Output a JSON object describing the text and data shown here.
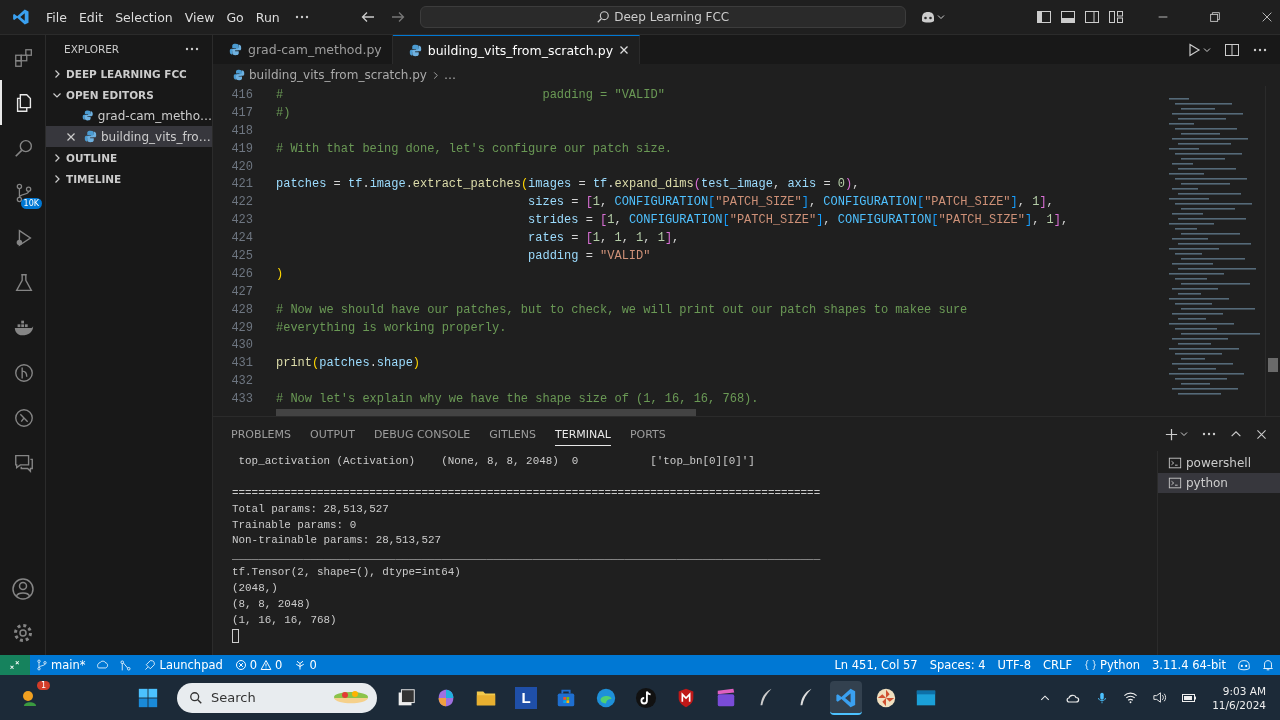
{
  "title_bar": {
    "menus": [
      "File",
      "Edit",
      "Selection",
      "View",
      "Go",
      "Run"
    ],
    "search": {
      "value": "Deep Learning FCC"
    }
  },
  "activity_bar": {
    "items": [
      {
        "kind": "extensions",
        "selected": false
      },
      {
        "kind": "explorer",
        "selected": true
      },
      {
        "kind": "search",
        "selected": false
      },
      {
        "kind": "source-control",
        "selected": false,
        "badge": "10K"
      },
      {
        "kind": "run",
        "selected": false
      },
      {
        "kind": "testing",
        "selected": false
      },
      {
        "kind": "docker",
        "selected": false
      },
      {
        "kind": "gitlens",
        "selected": false
      },
      {
        "kind": "remote",
        "selected": false
      },
      {
        "kind": "chat",
        "selected": false
      }
    ]
  },
  "sidebar": {
    "title": "EXPLORER",
    "sections": [
      {
        "label": "DEEP LEARNING FCC",
        "expanded": false
      },
      {
        "label": "OPEN EDITORS",
        "expanded": true,
        "children": [
          {
            "label": "grad-cam_metho…",
            "selected": false
          },
          {
            "label": "building_vits_fro…",
            "selected": true
          }
        ]
      },
      {
        "label": "OUTLINE",
        "expanded": false
      },
      {
        "label": "TIMELINE",
        "expanded": false
      }
    ]
  },
  "tabs": [
    {
      "label": "grad-cam_method.py",
      "selected": false
    },
    {
      "label": "building_vits_from_scratch.py",
      "selected": true
    }
  ],
  "breadcrumb": [
    "building_vits_from_scratch.py",
    "…"
  ],
  "code_lines": [
    {
      "num": "416",
      "parts": [
        {
          "kind": "comment",
          "text": "#                                    padding = \"VALID\""
        }
      ]
    },
    {
      "num": "417",
      "parts": [
        {
          "kind": "comment",
          "text": "#)"
        }
      ]
    },
    {
      "num": "418"
    },
    {
      "num": "419",
      "parts": [
        {
          "kind": "comment",
          "text": "# With that being done, let's configure our patch size."
        }
      ]
    },
    {
      "num": "420"
    },
    {
      "num": "421",
      "parts": [
        {
          "kind": "var",
          "text": "patches"
        },
        {
          "kind": "plain",
          "text": " = "
        },
        {
          "kind": "var",
          "text": "tf"
        },
        {
          "kind": "plain",
          "text": "."
        },
        {
          "kind": "var",
          "text": "image"
        },
        {
          "kind": "plain",
          "text": "."
        },
        {
          "kind": "func",
          "text": "extract_patches"
        },
        {
          "kind": "bracket1",
          "text": "("
        },
        {
          "kind": "var",
          "text": "images"
        },
        {
          "kind": "plain",
          "text": " = "
        },
        {
          "kind": "var",
          "text": "tf"
        },
        {
          "kind": "plain",
          "text": "."
        },
        {
          "kind": "func",
          "text": "expand_dims"
        },
        {
          "kind": "bracket2",
          "text": "("
        },
        {
          "kind": "var",
          "text": "test_image"
        },
        {
          "kind": "plain",
          "text": ", "
        },
        {
          "kind": "var",
          "text": "axis"
        },
        {
          "kind": "plain",
          "text": " = "
        },
        {
          "kind": "number",
          "text": "0"
        },
        {
          "kind": "bracket2",
          "text": ")"
        },
        {
          "kind": "plain",
          "text": ","
        }
      ]
    },
    {
      "num": "422",
      "parts": [
        {
          "kind": "var",
          "text": "                                   sizes"
        },
        {
          "kind": "plain",
          "text": " = "
        },
        {
          "kind": "bracket2",
          "text": "["
        },
        {
          "kind": "number",
          "text": "1"
        },
        {
          "kind": "plain",
          "text": ", "
        },
        {
          "kind": "const",
          "text": "CONFIGURATION"
        },
        {
          "kind": "bracket3",
          "text": "["
        },
        {
          "kind": "string",
          "text": "\"PATCH_SIZE\""
        },
        {
          "kind": "bracket3",
          "text": "]"
        },
        {
          "kind": "plain",
          "text": ", "
        },
        {
          "kind": "const",
          "text": "CONFIGURATION"
        },
        {
          "kind": "bracket3",
          "text": "["
        },
        {
          "kind": "string",
          "text": "\"PATCH_SIZE\""
        },
        {
          "kind": "bracket3",
          "text": "]"
        },
        {
          "kind": "plain",
          "text": ", "
        },
        {
          "kind": "number",
          "text": "1"
        },
        {
          "kind": "bracket2",
          "text": "]"
        },
        {
          "kind": "plain",
          "text": ","
        }
      ]
    },
    {
      "num": "423",
      "parts": [
        {
          "kind": "var",
          "text": "                                   strides"
        },
        {
          "kind": "plain",
          "text": " = "
        },
        {
          "kind": "bracket2",
          "text": "["
        },
        {
          "kind": "number",
          "text": "1"
        },
        {
          "kind": "plain",
          "text": ", "
        },
        {
          "kind": "const",
          "text": "CONFIGURATION"
        },
        {
          "kind": "bracket3",
          "text": "["
        },
        {
          "kind": "string",
          "text": "\"PATCH_SIZE\""
        },
        {
          "kind": "bracket3",
          "text": "]"
        },
        {
          "kind": "plain",
          "text": ", "
        },
        {
          "kind": "const",
          "text": "CONFIGURATION"
        },
        {
          "kind": "bracket3",
          "text": "["
        },
        {
          "kind": "string",
          "text": "\"PATCH_SIZE\""
        },
        {
          "kind": "bracket3",
          "text": "]"
        },
        {
          "kind": "plain",
          "text": ", "
        },
        {
          "kind": "number",
          "text": "1"
        },
        {
          "kind": "bracket2",
          "text": "]"
        },
        {
          "kind": "plain",
          "text": ","
        }
      ]
    },
    {
      "num": "424",
      "parts": [
        {
          "kind": "var",
          "text": "                                   rates"
        },
        {
          "kind": "plain",
          "text": " = "
        },
        {
          "kind": "bracket2",
          "text": "["
        },
        {
          "kind": "number",
          "text": "1"
        },
        {
          "kind": "plain",
          "text": ", "
        },
        {
          "kind": "number",
          "text": "1"
        },
        {
          "kind": "plain",
          "text": ", "
        },
        {
          "kind": "number",
          "text": "1"
        },
        {
          "kind": "plain",
          "text": ", "
        },
        {
          "kind": "number",
          "text": "1"
        },
        {
          "kind": "bracket2",
          "text": "]"
        },
        {
          "kind": "plain",
          "text": ","
        }
      ]
    },
    {
      "num": "425",
      "parts": [
        {
          "kind": "var",
          "text": "                                   padding"
        },
        {
          "kind": "plain",
          "text": " = "
        },
        {
          "kind": "string",
          "text": "\"VALID\""
        }
      ]
    },
    {
      "num": "426",
      "parts": [
        {
          "kind": "bracket1",
          "text": ")"
        }
      ]
    },
    {
      "num": "427"
    },
    {
      "num": "428",
      "parts": [
        {
          "kind": "comment",
          "text": "# Now we should have our patches, but to check, we will print out our patch shapes to makee sure"
        }
      ]
    },
    {
      "num": "429",
      "parts": [
        {
          "kind": "comment",
          "text": "#everything is working properly."
        }
      ]
    },
    {
      "num": "430"
    },
    {
      "num": "431",
      "parts": [
        {
          "kind": "func",
          "text": "print"
        },
        {
          "kind": "bracket1",
          "text": "("
        },
        {
          "kind": "var",
          "text": "patches"
        },
        {
          "kind": "plain",
          "text": "."
        },
        {
          "kind": "var",
          "text": "shape"
        },
        {
          "kind": "bracket1",
          "text": ")"
        }
      ]
    },
    {
      "num": "432"
    },
    {
      "num": "433",
      "parts": [
        {
          "kind": "comment",
          "text": "# Now let's explain why we have the shape size of (1, 16, 16, 768)."
        }
      ]
    }
  ],
  "panel": {
    "tabs": [
      {
        "label": "PROBLEMS",
        "selected": false
      },
      {
        "label": "OUTPUT",
        "selected": false
      },
      {
        "label": "DEBUG CONSOLE",
        "selected": false
      },
      {
        "label": "GITLENS",
        "selected": false
      },
      {
        "label": "TERMINAL",
        "selected": true
      },
      {
        "label": "PORTS",
        "selected": false
      }
    ],
    "terminal_lines": [
      {
        "text": " top_activation (Activation)    (None, 8, 8, 2048)  0           ['top_bn[0][0]']",
        "blank_before": false
      },
      {
        "text": "==========================================================================================",
        "blank_before": true
      },
      {
        "text": "Total params: 28,513,527",
        "blank_before": false
      },
      {
        "text": "Trainable params: 0",
        "blank_before": false
      },
      {
        "text": "Non-trainable params: 28,513,527",
        "blank_before": false
      },
      {
        "text": "__________________________________________________________________________________________",
        "blank_before": false
      },
      {
        "text": "tf.Tensor(2, shape=(), dtype=int64)",
        "blank_before": false
      },
      {
        "text": "(2048,)",
        "blank_before": false
      },
      {
        "text": "(8, 8, 2048)",
        "blank_before": false
      },
      {
        "text": "(1, 16, 16, 768)",
        "blank_before": false
      }
    ],
    "terminals": [
      {
        "label": "powershell",
        "selected": false
      },
      {
        "label": "python",
        "selected": true
      }
    ]
  },
  "status_bar": {
    "branch": "main*",
    "launchpad": "Launchpad",
    "errors": "0",
    "warnings": "0",
    "ports": "0",
    "right": [
      "Ln 451, Col 57",
      "Spaces: 4",
      "UTF-8",
      "CRLF"
    ],
    "language": "Python",
    "interpreter": "3.11.4 64-bit"
  },
  "taskbar": {
    "weather_badge": "1",
    "search": {
      "placeholder": "Search"
    },
    "app_letter": "L",
    "time": "9:03 AM",
    "date": "11/6/2024"
  }
}
